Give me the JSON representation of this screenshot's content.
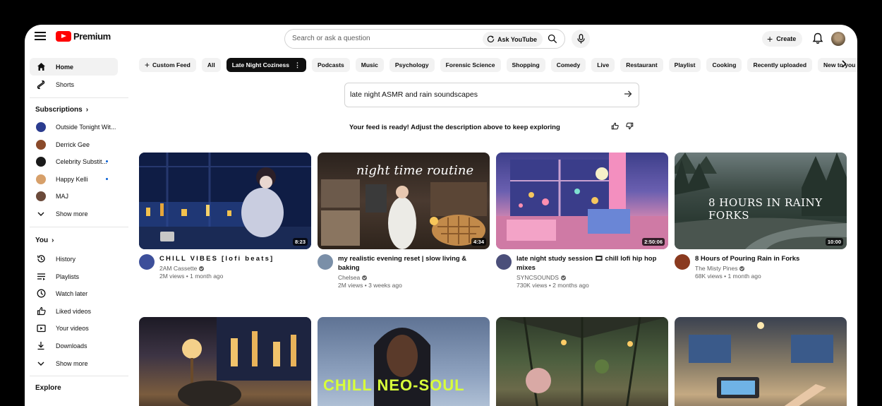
{
  "header": {
    "logo_text": "Premium",
    "search_placeholder": "Search or ask a question",
    "ask_label": "Ask YouTube",
    "create_label": "Create"
  },
  "sidebar": {
    "main": [
      {
        "label": "Home",
        "icon": "home-icon"
      },
      {
        "label": "Shorts",
        "icon": "shorts-icon"
      }
    ],
    "subscriptions_heading": "Subscriptions",
    "subscriptions": [
      {
        "label": "Outside Tonight Wit...",
        "color": "#2b3c8f",
        "live": false
      },
      {
        "label": "Derrick Gee",
        "color": "#8a4a2a",
        "live": false
      },
      {
        "label": "Celebrity Substit...",
        "color": "#1a1a1a",
        "live": true
      },
      {
        "label": "Happy Kelli",
        "color": "#d7a06a",
        "live": true
      },
      {
        "label": "MAJ",
        "color": "#6b4a3a",
        "live": false
      }
    ],
    "show_more": "Show more",
    "you_heading": "You",
    "you_items": [
      {
        "label": "History",
        "icon": "history-icon"
      },
      {
        "label": "Playlists",
        "icon": "playlists-icon"
      },
      {
        "label": "Watch later",
        "icon": "watch-later-icon"
      },
      {
        "label": "Liked videos",
        "icon": "thumbs-up-icon"
      },
      {
        "label": "Your videos",
        "icon": "your-videos-icon"
      },
      {
        "label": "Downloads",
        "icon": "download-icon"
      },
      {
        "label": "Show more",
        "icon": "chevron-down-icon"
      }
    ],
    "explore_heading": "Explore"
  },
  "chips": [
    "Custom Feed",
    "All",
    "Late Night Coziness",
    "Podcasts",
    "Music",
    "Psychology",
    "Forensic Science",
    "Shopping",
    "Comedy",
    "Live",
    "Restaurant",
    "Playlist",
    "Cooking",
    "Recently uploaded",
    "New to you"
  ],
  "feed": {
    "prompt": "late night ASMR and rain soundscapes",
    "ready": "Your feed is ready! Adjust the description above to keep exploring"
  },
  "videos": [
    {
      "title": "CHILL VIBES [lofi beats]",
      "channel": "2AM Cassette",
      "stats": "2M views • 1 month ago",
      "duration": "8:23",
      "verified": true,
      "avatar_color": "#3d4f9a"
    },
    {
      "title": "my realistic evening reset | slow living & baking",
      "channel": "Chelsea",
      "stats": "2M views • 3 weeks ago",
      "duration": "4:34",
      "verified": true,
      "avatar_color": "#7a8fa8",
      "overlay": "night time routine"
    },
    {
      "title": "late night study session 🎞 chill lofi hip hop mixes",
      "channel": "SYNCSOUNDS",
      "stats": "730K views • 2 months ago",
      "duration": "2:50:06",
      "verified": true,
      "avatar_color": "#4b4f7a"
    },
    {
      "title": "8 Hours of Pouring Rain in Forks",
      "channel": "The Misty Pines",
      "stats": "68K views • 1 month ago",
      "duration": "10:00",
      "verified": true,
      "avatar_color": "#8a3a1f",
      "overlay": "8 HOURS IN RAINY FORKS"
    },
    {
      "title": "",
      "channel": "",
      "stats": "",
      "duration": ""
    },
    {
      "title": "",
      "channel": "",
      "stats": "",
      "duration": "",
      "overlay": "CHILL NEO-SOUL"
    },
    {
      "title": "",
      "channel": "",
      "stats": "",
      "duration": ""
    },
    {
      "title": "",
      "channel": "",
      "stats": "",
      "duration": ""
    }
  ]
}
